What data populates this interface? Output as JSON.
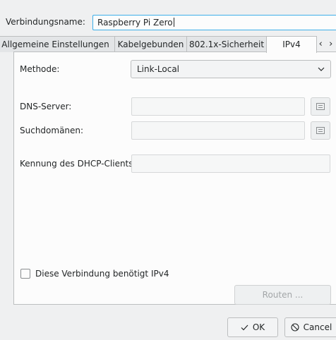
{
  "connection": {
    "name_label": "Verbindungsname:",
    "name_value": "Raspberry Pi Zero"
  },
  "tabs": [
    {
      "label": "Allgemeine Einstellungen",
      "active": false
    },
    {
      "label": "Kabelgebunden",
      "active": false
    },
    {
      "label": "802.1x-Sicherheit",
      "active": false
    },
    {
      "label": "IPv4",
      "active": true
    }
  ],
  "tab_scroll": {
    "left": "‹",
    "right": "›"
  },
  "ipv4": {
    "method_label": "Methode:",
    "method_value": "Link-Local",
    "dns_label": "DNS-Server:",
    "dns_value": "",
    "search_domains_label": "Suchdomänen:",
    "search_domains_value": "",
    "dhcp_client_id_label": "Kennung des DHCP-Clients:",
    "dhcp_client_id_value": "",
    "require_ipv4_label": "Diese Verbindung benötigt IPv4",
    "require_ipv4_checked": false,
    "routes_button": "Routen ..."
  },
  "footer": {
    "ok_label": "OK",
    "cancel_label": "Cancel"
  },
  "colors": {
    "accent": "#3daee9",
    "window_bg": "#eff0f1",
    "panel_bg": "#fcfcfc",
    "border": "#bcbebf"
  }
}
